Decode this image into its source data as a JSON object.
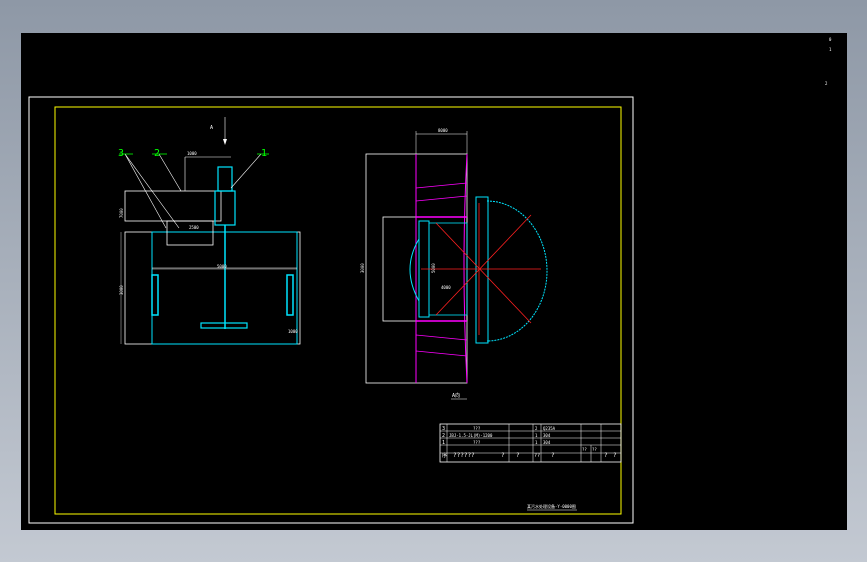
{
  "colors": {
    "background": "#000000",
    "white": "#ffffff",
    "yellow": "#ffff00",
    "cyan": "#00e5ff",
    "green": "#00ff00",
    "magenta": "#ff00ff",
    "red": "#ff2020"
  },
  "side_view": {
    "labels": [
      {
        "text": "3",
        "color": "green"
      },
      {
        "text": "2",
        "color": "green"
      },
      {
        "text": "1",
        "color": "green"
      }
    ],
    "section_mark": "A",
    "dims": [
      "5000",
      "7000",
      "1000",
      "3000",
      "2500",
      "1000"
    ]
  },
  "plan_view": {
    "title": "A向",
    "dims": [
      "8000",
      "3000",
      "5000",
      "4000"
    ]
  },
  "parts_table": {
    "rows": [
      {
        "no": "3",
        "name": "???",
        "qty": "2",
        "material": "Q235A"
      },
      {
        "no": "2",
        "name": "JBJ-1.5-JL(M)-1200",
        "qty": "1",
        "material": "304"
      },
      {
        "no": "1",
        "name": "???",
        "qty": "1",
        "material": "304"
      }
    ],
    "header": [
      "序",
      "??????",
      "?",
      "?",
      "??",
      "?",
      "??",
      "??",
      "?",
      "?"
    ]
  },
  "title_block": {
    "caption": "某污水处理设备-Y-0000图"
  },
  "side_marks": [
    "0",
    "1",
    "2"
  ]
}
